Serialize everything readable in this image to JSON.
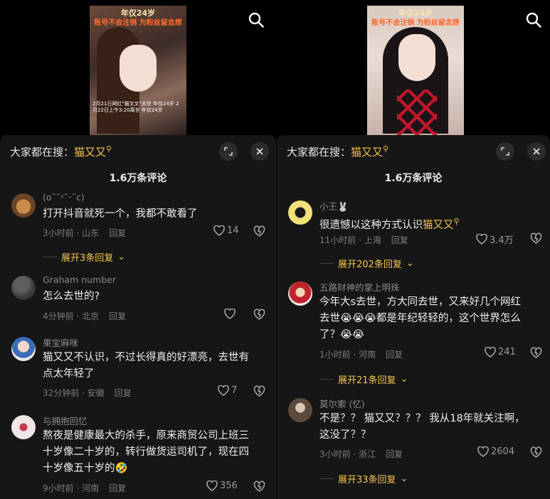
{
  "left": {
    "thumb": {
      "line1": "年仅24岁",
      "line2": "账号不会注销 为粉丝留念想",
      "line3": "2月21日网红\"猫叉叉\"去世 年仅24岁 2月22日上午3:20离世 年仅24岁"
    },
    "search": {
      "prefix": "大家都在搜：",
      "keyword": "猫又又"
    },
    "count": "1.6万条评论",
    "comments": [
      {
        "user": "(o˘˘ᵌ˘ᵕ˘c)",
        "text": "打开抖音就死一个，我都不敢看了",
        "time": "3小时前 · 山东",
        "reply": "回复",
        "likes": "14",
        "expand": "展开3条回复"
      },
      {
        "user": "Graham number",
        "text": "怎么去世的?",
        "time": "4分钟前 · 北京",
        "reply": "回复",
        "likes": "",
        "expand": ""
      },
      {
        "user": "果宝麻咪",
        "text": "猫又又不认识，不过长得真的好漂亮，去世有点太年轻了",
        "time": "32分钟前 · 安徽",
        "reply": "回复",
        "likes": "7",
        "expand": ""
      },
      {
        "user": "与拥抱回忆",
        "text": "熬夜是健康最大的杀手，原来商贸公司上班三十岁像二十岁的，转行做货运司机了，现在四十岁像五十岁的🤣",
        "time": "9小时前 · 河南",
        "reply": "回复",
        "likes": "356",
        "expand": ""
      }
    ]
  },
  "right": {
    "thumb": {
      "line1": "年仅24岁",
      "line2": "账号不会注销 为粉丝留念想"
    },
    "search": {
      "prefix": "大家都在搜：",
      "keyword": "猫又又"
    },
    "count": "1.6万条评论",
    "comments": [
      {
        "user": "小王🐰",
        "text_pre": "很遗憾以这种方式认识",
        "text_kw": "猫又又",
        "time": "11小时前 · 上海",
        "reply": "回复",
        "likes": "3.4万",
        "expand": "展开202条回复"
      },
      {
        "user": "五路财神的掌上明珠",
        "text": "今年大s去世，方大同去世，又来好几个网红去世😭😭😭都是年纪轻轻的，这个世界怎么了？😭😭",
        "time": "1小时前 · 河南",
        "reply": "回复",
        "likes": "241",
        "expand": "展开21条回复"
      },
      {
        "user": "莫尔索 (忆)",
        "text": "不是？？ 猫又又？？？ 我从18年就关注啊，这没了？？",
        "time": "3小时前 · 浙江",
        "reply": "回复",
        "likes": "2604",
        "expand": "展开33条回复"
      }
    ]
  },
  "colors": {
    "accent": "#f5c74e",
    "sheet": "#161616"
  }
}
